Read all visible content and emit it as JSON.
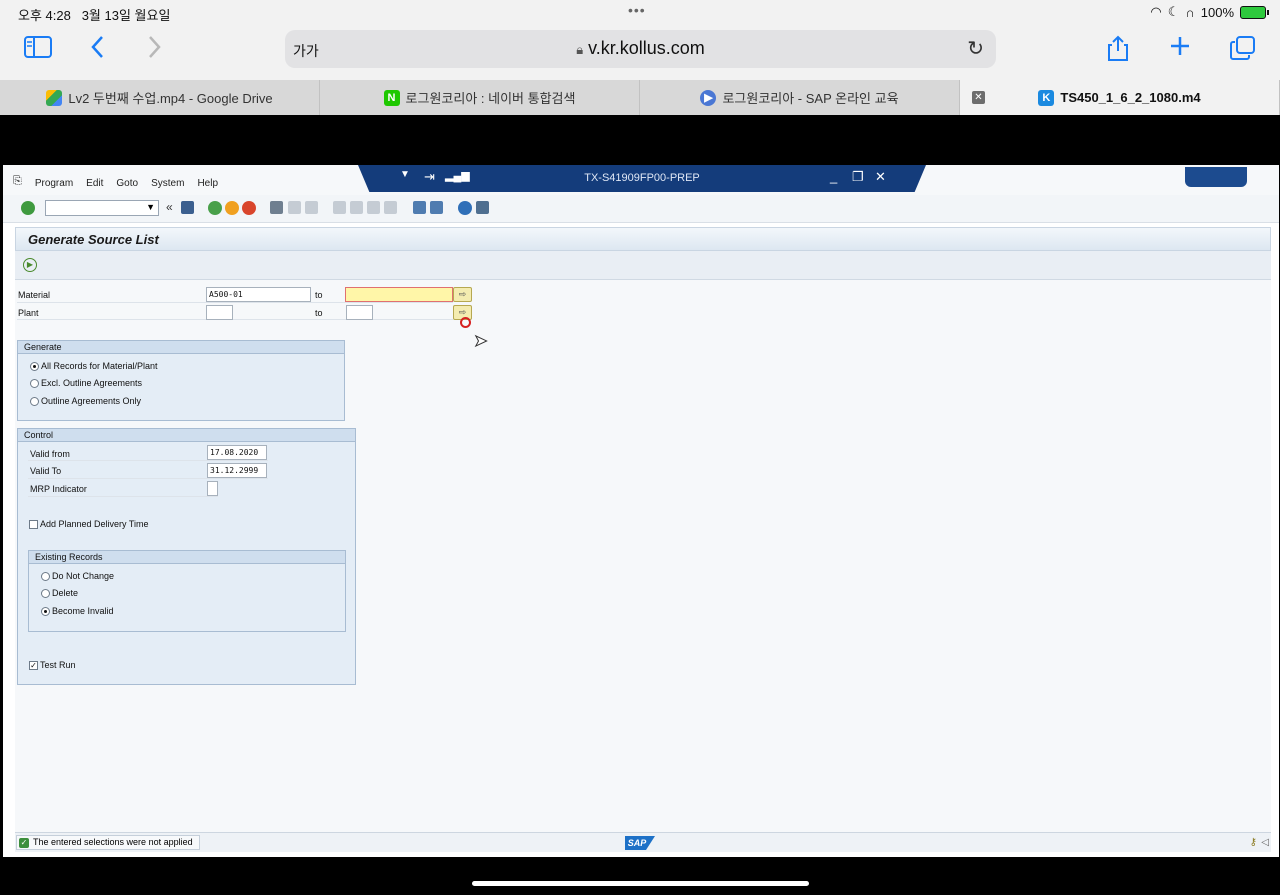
{
  "status_bar": {
    "time": "오후 4:28",
    "date": "3월 13일 월요일",
    "battery": "100%"
  },
  "browser": {
    "text_size_label": "가가",
    "url": "v.kr.kollus.com",
    "tabs": [
      {
        "title": "Lv2 두번째 수업.mp4 - Google Drive",
        "icon": "google-drive-icon"
      },
      {
        "title": "로그원코리아 : 네이버 통합검색",
        "icon": "naver-icon"
      },
      {
        "title": "로그원코리아 - SAP 온라인 교육",
        "icon": "play-icon"
      },
      {
        "title": "TS450_1_6_2_1080.m4",
        "icon": "kollus-icon",
        "active": true
      }
    ]
  },
  "sap": {
    "menu": [
      "Program",
      "Edit",
      "Goto",
      "System",
      "Help"
    ],
    "window_title": "TX-S41909FP00-PREP",
    "page_title": "Generate Source List",
    "selection": {
      "material_label": "Material",
      "material_from": "A500-01",
      "material_to": "",
      "plant_label": "Plant",
      "plant_from": "",
      "plant_to": "",
      "to_label": "to"
    },
    "generate_group": {
      "title": "Generate",
      "options": [
        {
          "label": "All Records for Material/Plant",
          "selected": true
        },
        {
          "label": "Excl. Outline Agreements",
          "selected": false
        },
        {
          "label": "Outline Agreements Only",
          "selected": false
        }
      ]
    },
    "control_group": {
      "title": "Control",
      "valid_from_label": "Valid from",
      "valid_from": "17.08.2020",
      "valid_to_label": "Valid To",
      "valid_to": "31.12.2999",
      "mrp_label": "MRP Indicator",
      "mrp_value": "",
      "add_planned_label": "Add Planned Delivery Time",
      "add_planned_checked": false,
      "existing_records": {
        "title": "Existing Records",
        "options": [
          {
            "label": "Do Not Change",
            "selected": false
          },
          {
            "label": "Delete",
            "selected": false
          },
          {
            "label": "Become Invalid",
            "selected": true
          }
        ]
      },
      "test_run_label": "Test Run",
      "test_run_checked": true
    },
    "status_message": "The entered selections were not applied",
    "logo_text": "SAP"
  }
}
